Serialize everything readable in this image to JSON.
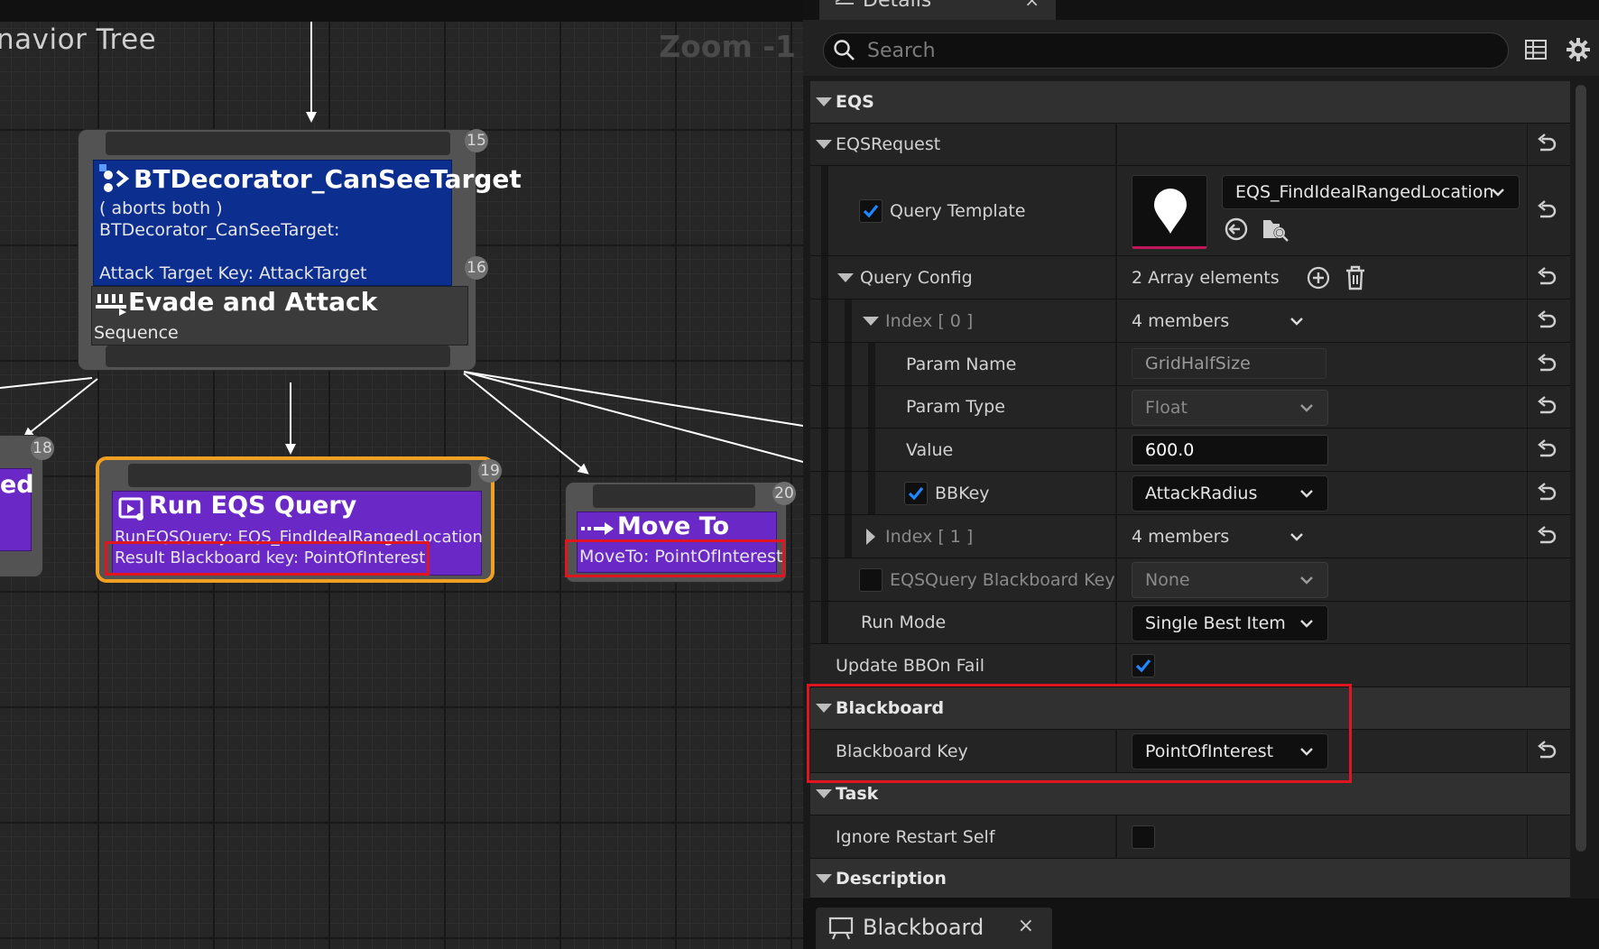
{
  "graph": {
    "title": "navior Tree",
    "zoom": "Zoom -1",
    "root_node": {
      "index_top": "15",
      "index_decorator": "16",
      "decorator": {
        "title": "BTDecorator_CanSeeTarget",
        "lines": [
          "( aborts both )",
          "BTDecorator_CanSeeTarget:",
          "",
          "Attack Target Key: AttackTarget"
        ]
      },
      "composite": {
        "title": "Evade and Attack",
        "subtitle": "Sequence"
      }
    },
    "left_node": {
      "index": "18",
      "title_fragment": "ed"
    },
    "eqs_node": {
      "index": "19",
      "title": "Run EQS Query",
      "line1": "RunEQSQuery: EQS_FindIdealRangedLocation",
      "line2": "Result Blackboard key: PointOfInterest"
    },
    "moveto_node": {
      "index": "20",
      "title": "Move To",
      "line1": "MoveTo: PointOfInterest"
    }
  },
  "panel": {
    "tab_label": "Details",
    "search_placeholder": "Search",
    "categories": {
      "eqs": "EQS",
      "blackboard": "Blackboard",
      "task": "Task",
      "description": "Description"
    },
    "eqs_request": {
      "label": "EQSRequest",
      "query_template_label": "Query Template",
      "query_template_value": "EQS_FindIdealRangedLocation",
      "query_config_label": "Query Config",
      "query_config_value": "2 Array elements",
      "index0_label": "Index [ 0 ]",
      "index0_value": "4 members",
      "param_name_label": "Param Name",
      "param_name_value": "GridHalfSize",
      "param_type_label": "Param Type",
      "param_type_value": "Float",
      "value_label": "Value",
      "value_value": "600.0",
      "bbkey_label": "BBKey",
      "bbkey_value": "AttackRadius",
      "index1_label": "Index [ 1 ]",
      "index1_value": "4 members",
      "eqsquery_bbkey_label": "EQSQuery Blackboard Key",
      "eqsquery_bbkey_value": "None",
      "run_mode_label": "Run Mode",
      "run_mode_value": "Single Best Item"
    },
    "update_bb_on_fail_label": "Update BBOn Fail",
    "blackboard_key_label": "Blackboard Key",
    "blackboard_key_value": "PointOfInterest",
    "ignore_restart_self_label": "Ignore Restart Self",
    "bottom_tab_label": "Blackboard"
  },
  "colors": {
    "decorator": "#0b2e8f",
    "task": "#6a28c7",
    "selected_outline": "#f0a020",
    "highlight": "#e0151f",
    "check": "#1e88ff"
  }
}
